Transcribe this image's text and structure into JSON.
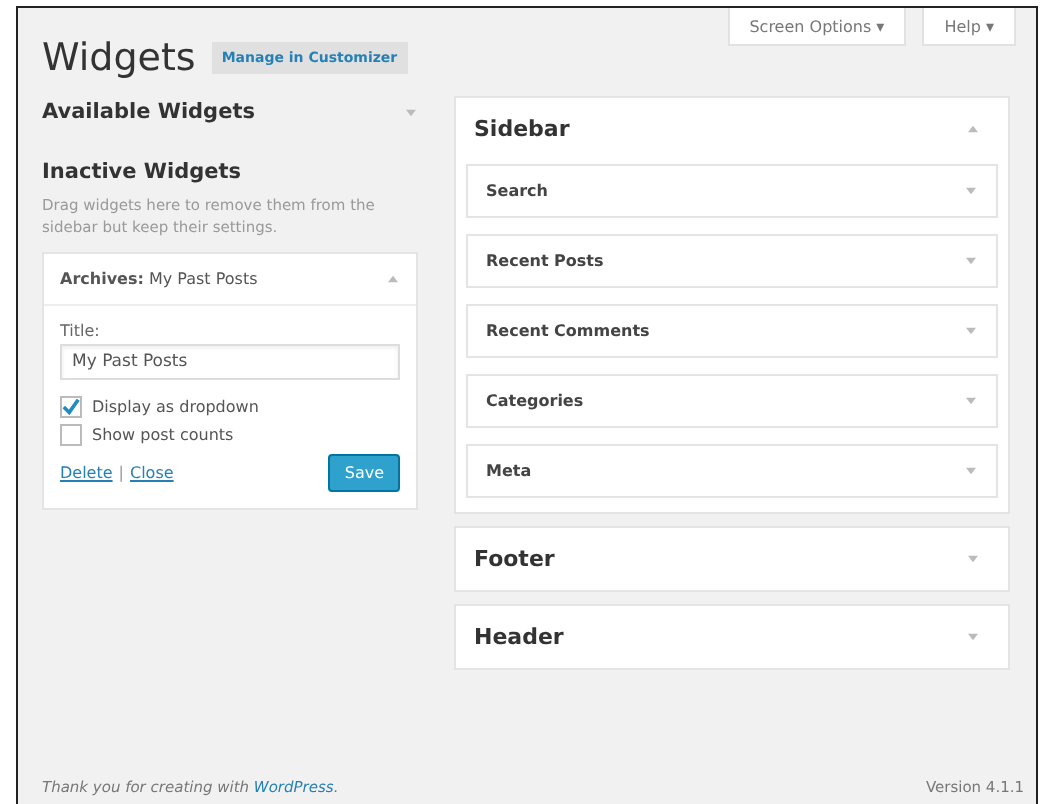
{
  "header": {
    "screen_options": "Screen Options ▾",
    "help": "Help ▾",
    "title": "Widgets",
    "manage_button": "Manage in Customizer"
  },
  "available": {
    "title": "Available Widgets",
    "expanded": false
  },
  "inactive": {
    "title": "Inactive Widgets",
    "description": "Drag widgets here to remove them from the sidebar but keep their settings."
  },
  "widget": {
    "title": "**Archives:** My Past Posts",
    "expanded": true,
    "field_label": "Title:",
    "field_value": "My Past Posts",
    "options": [
      {
        "label": "Display as dropdown",
        "checked": true
      },
      {
        "label": "Show post counts",
        "checked": false
      }
    ],
    "delete": "Delete",
    "separator": "|",
    "close": "Close",
    "save": "Save"
  },
  "areas": [
    {
      "title": "Sidebar",
      "expanded": true,
      "widgets": [
        "Search",
        "Recent Posts",
        "Recent Comments",
        "Categories",
        "Meta"
      ]
    },
    {
      "title": "Footer",
      "expanded": false
    },
    {
      "title": "Header",
      "expanded": false
    }
  ],
  "footer": {
    "thanks": "Thank you for creating with ",
    "link": "WordPress",
    "end": ".",
    "version": "Version 4.1.1"
  }
}
